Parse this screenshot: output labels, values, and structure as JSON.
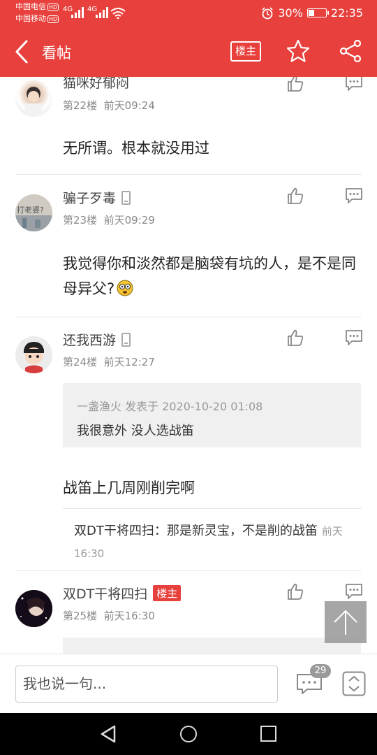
{
  "status_bar": {
    "carrier1": "中国电信",
    "carrier2": "中国移动",
    "hd": "HD",
    "network": "4G",
    "battery": "30%",
    "battery_level": 0.3,
    "time": "22:35"
  },
  "header": {
    "title": "看帖",
    "op_only_label": "楼主"
  },
  "posts": [
    {
      "username": "猫咪好郁闷",
      "floor": "第22楼",
      "time": "前天09:24",
      "text": "无所谓。根本就没用过"
    },
    {
      "username": "骗子歹毒",
      "floor": "第23楼",
      "time": "前天09:29",
      "text": "我觉得你和淡然都是脑袋有坑的人，是不是同母异父?",
      "avatar_text": "打老婆?"
    },
    {
      "username": "还我西游",
      "floor": "第24楼",
      "time": "前天12:27",
      "quote_meta": "一盏渔火 发表于 2020-10-20 01:08",
      "quote_text": "我很意外 没人选战笛",
      "text": "战笛上几周刚削完啊",
      "reply_author": "双DT干将四扫",
      "reply_sep": "：",
      "reply_text": "那是新灵宝，不是削的战笛",
      "reply_time": "前天16:30"
    },
    {
      "username": "双DT干将四扫",
      "op_tag": "楼主",
      "floor": "第25楼",
      "time": "前天16:30"
    }
  ],
  "bottom": {
    "input_placeholder": "我也说一句...",
    "comment_count": "29"
  },
  "colors": {
    "brand": "#e8413d"
  }
}
